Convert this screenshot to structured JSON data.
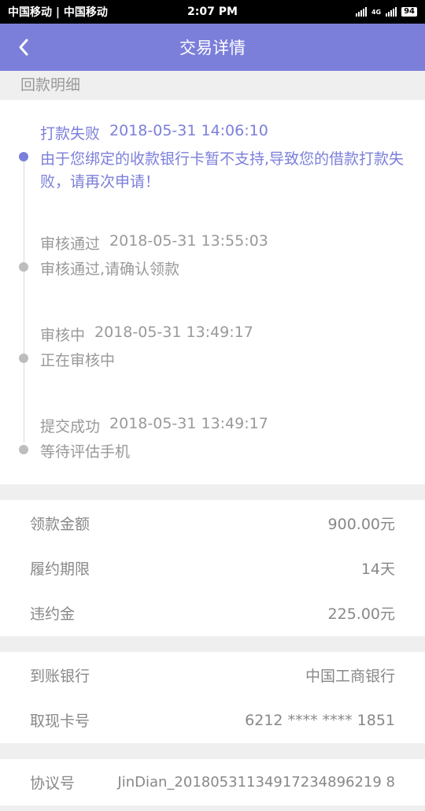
{
  "status_bar": {
    "carrier": "中国移动 | 中国移动",
    "time": "2:07 PM",
    "network": "4G",
    "battery": "94"
  },
  "nav": {
    "title": "交易详情"
  },
  "section": {
    "title": "回款明细"
  },
  "timeline": [
    {
      "status": "打款失败",
      "time": "2018-05-31 14:06:10",
      "desc": "由于您绑定的收款银行卡暂不支持,导致您的借款打款失败，请再次申请！",
      "active": true
    },
    {
      "status": "审核通过",
      "time": "2018-05-31 13:55:03",
      "desc": "审核通过,请确认领款",
      "active": false
    },
    {
      "status": "审核中",
      "time": "2018-05-31 13:49:17",
      "desc": "正在审核中",
      "active": false
    },
    {
      "status": "提交成功",
      "time": "2018-05-31 13:49:17",
      "desc": "等待评估手机",
      "active": false
    }
  ],
  "loan": [
    {
      "label": "领款金额",
      "value": "900.00元"
    },
    {
      "label": "履约期限",
      "value": "14天"
    },
    {
      "label": "违约金",
      "value": "225.00元"
    }
  ],
  "bank": [
    {
      "label": "到账银行",
      "value": "中国工商银行"
    },
    {
      "label": "取现卡号",
      "value": "6212 **** **** 1851"
    }
  ],
  "agreement": [
    {
      "label": "协议号",
      "value": "JinDian_20180531134917234896219 8"
    }
  ]
}
